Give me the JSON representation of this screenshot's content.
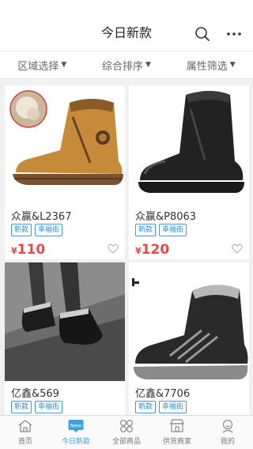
{
  "header": {
    "title": "今日新款"
  },
  "filters": [
    {
      "label": "区域选择"
    },
    {
      "label": "综合排序"
    },
    {
      "label": "属性筛选"
    }
  ],
  "products": [
    {
      "name": "众赢&L2367",
      "tags": [
        "新款",
        "幸福街"
      ],
      "currency": "¥",
      "price": "110"
    },
    {
      "name": "众赢&P8063",
      "tags": [
        "新款",
        "幸福街"
      ],
      "currency": "¥",
      "price": "120"
    },
    {
      "name": "亿鑫&569",
      "tags": [
        "新款",
        "幸福街"
      ]
    },
    {
      "name": "亿鑫&7706",
      "tags": [
        "新款",
        "幸福街"
      ]
    }
  ],
  "tabbar": [
    {
      "label": "首页",
      "icon": "home-icon"
    },
    {
      "label": "今日新款",
      "icon": "new-badge-icon",
      "active": true,
      "badge": "New"
    },
    {
      "label": "全部商品",
      "icon": "grid-icon"
    },
    {
      "label": "供货商家",
      "icon": "store-icon"
    },
    {
      "label": "我的",
      "icon": "user-icon"
    }
  ],
  "colors": {
    "accent": "#3aa0e6",
    "price": "#e8484a",
    "tag": "#2a8fd6"
  }
}
